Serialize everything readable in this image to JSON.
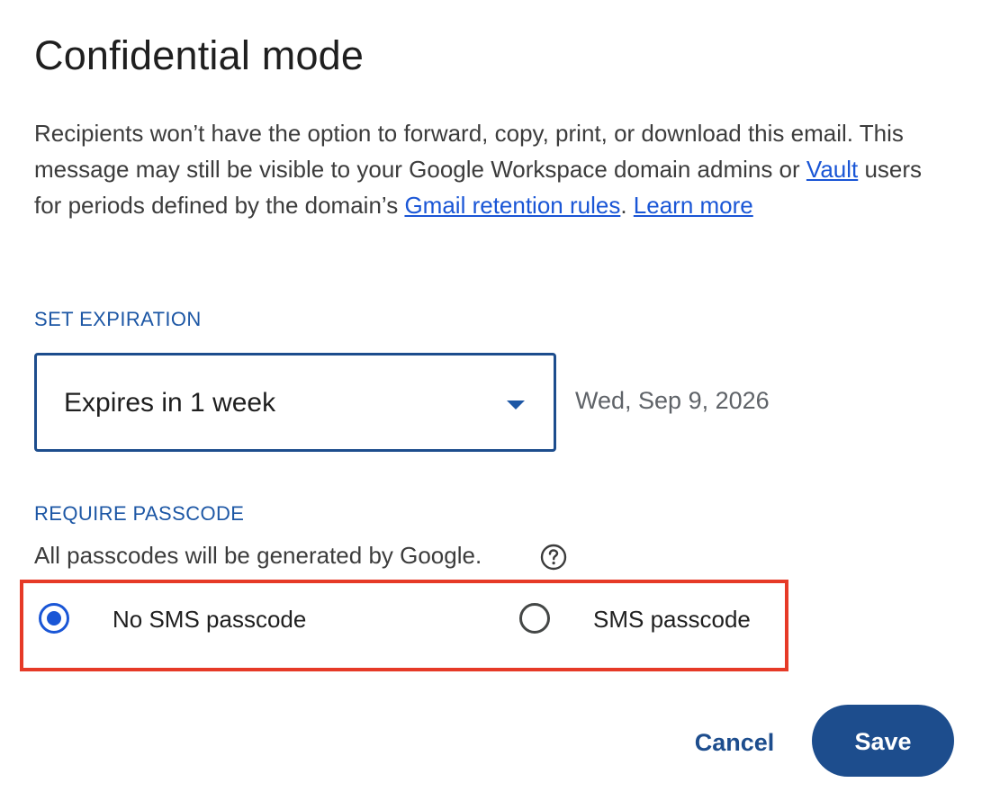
{
  "dialog": {
    "title": "Confidential mode",
    "description": {
      "part1": "Recipients won’t have the option to forward, copy, print, or download this email. This message may still be visible to your Google Workspace domain admins or ",
      "vault_link": "Vault",
      "part2": " users for periods defined by the domain’s ",
      "retention_link": "Gmail retention rules",
      "part3": ". ",
      "learn_more_link": "Learn more"
    }
  },
  "expiration": {
    "label": "SET EXPIRATION",
    "selected": "Expires in 1 week",
    "date": "Wed, Sep 9, 2026"
  },
  "passcode": {
    "label": "REQUIRE PASSCODE",
    "note": "All passcodes will be generated by Google.",
    "options": [
      {
        "label": "No SMS passcode",
        "selected": true
      },
      {
        "label": "SMS passcode",
        "selected": false
      }
    ]
  },
  "actions": {
    "cancel": "Cancel",
    "save": "Save"
  },
  "colors": {
    "accent": "#1d4d8d",
    "link": "#1a56d6",
    "highlight_border": "#e63a27"
  },
  "icons": {
    "help": "help-circle-icon",
    "dropdown": "dropdown-arrow-icon"
  }
}
